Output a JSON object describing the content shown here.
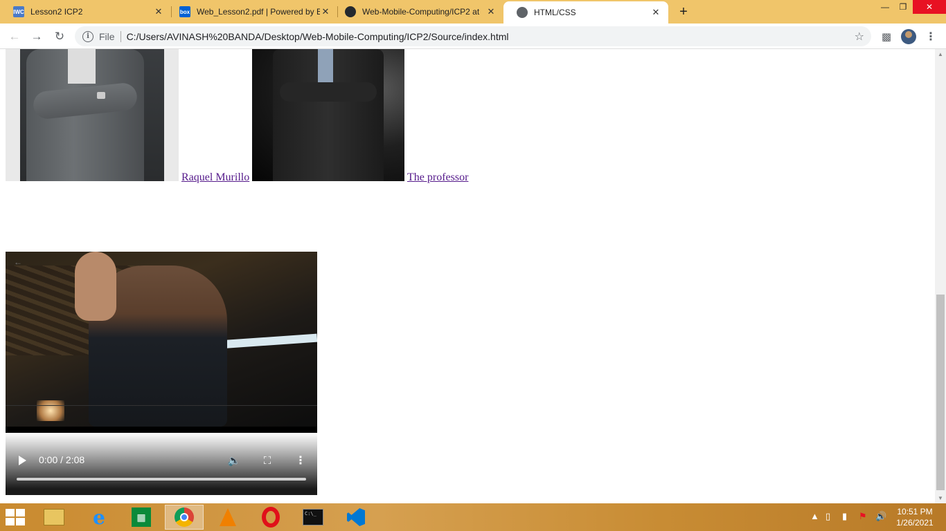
{
  "browser": {
    "tabs": [
      {
        "title": "Lesson2 ICP2",
        "favicon_text": "IWC",
        "favicon_color": "#4a7ac8",
        "active": false
      },
      {
        "title": "Web_Lesson2.pdf | Powered by B",
        "favicon_text": "box",
        "favicon_color": "#0061d5",
        "active": false
      },
      {
        "title": "Web-Mobile-Computing/ICP2 at",
        "favicon_text": "gh",
        "favicon_color": "#24292e",
        "active": false
      },
      {
        "title": "HTML/CSS",
        "favicon_text": "globe",
        "favicon_color": "#5f6368",
        "active": true
      }
    ],
    "address_bar": {
      "scheme_label": "File",
      "url": "C:/Users/AVINASH%20BANDA/Desktop/Web-Mobile-Computing/ICP2/Source/index.html"
    }
  },
  "page": {
    "links": [
      {
        "label": "Raquel Murillo"
      },
      {
        "label": "The professor"
      }
    ],
    "video": {
      "time": "0:00 / 2:08",
      "progress": 0
    }
  },
  "taskbar": {
    "apps": [
      "file-explorer",
      "internet-explorer",
      "store",
      "chrome",
      "vlc",
      "opera",
      "command-prompt",
      "vscode"
    ],
    "active_app": "chrome",
    "clock": {
      "time": "10:51 PM",
      "date": "1/26/2021"
    }
  },
  "colors": {
    "tabstrip": "#f0c56a",
    "link_visited": "#551a8b",
    "taskbar": "#c98a2f"
  }
}
